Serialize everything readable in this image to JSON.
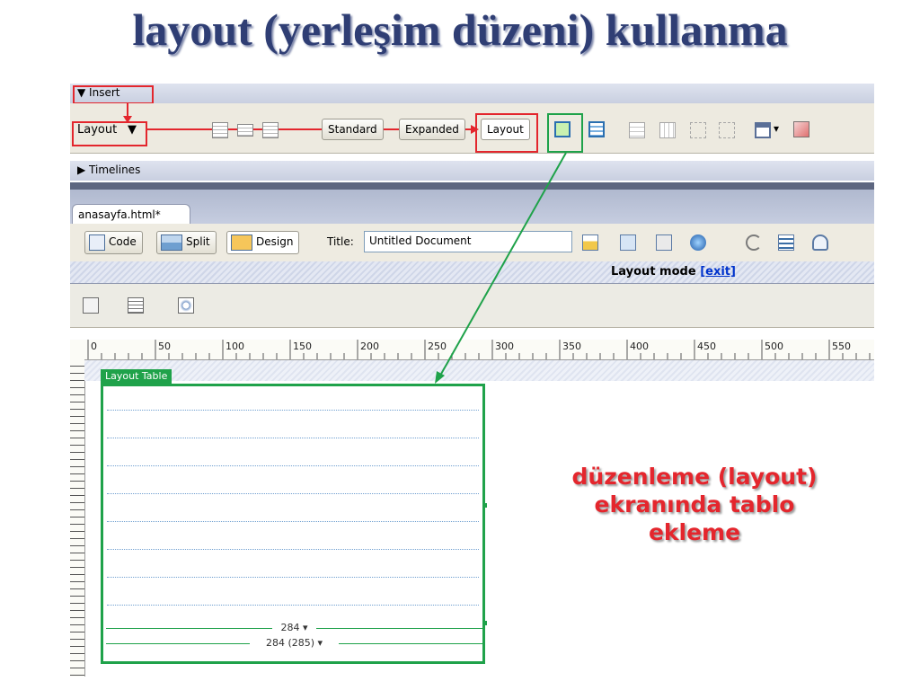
{
  "slide": {
    "title": "layout (yerleşim düzeni) kullanma"
  },
  "insert_bar": {
    "header": "▼ Insert",
    "category": "Layout",
    "category_arrow": "▼",
    "view_buttons": [
      "Standard",
      "Expanded",
      "Layout"
    ],
    "dropdown_arrow": "▾"
  },
  "timelines": {
    "label": "▶ Timelines"
  },
  "document": {
    "tab": "anasayfa.html*",
    "code_label": "Code",
    "split_label": "Split",
    "design_label": "Design",
    "title_label": "Title:",
    "title_value": "Untitled Document"
  },
  "layout_mode": {
    "text": "Layout mode ",
    "exit": "[exit]"
  },
  "ruler": {
    "ticks": [
      "0",
      "50",
      "100",
      "150",
      "200",
      "250",
      "300",
      "350",
      "400",
      "450",
      "500",
      "550"
    ]
  },
  "layout_table": {
    "label": "Layout Table",
    "column_width": "284 ▾",
    "table_width": "284 (285) ▾"
  },
  "callout": {
    "lines": [
      "düzenleme (layout)",
      "ekranında tablo",
      "ekleme"
    ]
  },
  "colors": {
    "title": "#2f3e74",
    "annotation_red": "#e3262d",
    "annotation_green": "#1fa24a",
    "callout": "#e4262d"
  },
  "icons": [
    "table-icon",
    "expanded-table-icon",
    "layout-table-icon",
    "draw-layout-cell-icon",
    "split-cell-icon",
    "insert-row-icon",
    "insert-column-icon",
    "frames-icon",
    "flash-icon",
    "validate-icon",
    "file-management-icon",
    "preview-icon",
    "refresh-icon",
    "view-options-icon",
    "visual-aids-icon",
    "code-icon",
    "split-icon",
    "design-icon"
  ]
}
